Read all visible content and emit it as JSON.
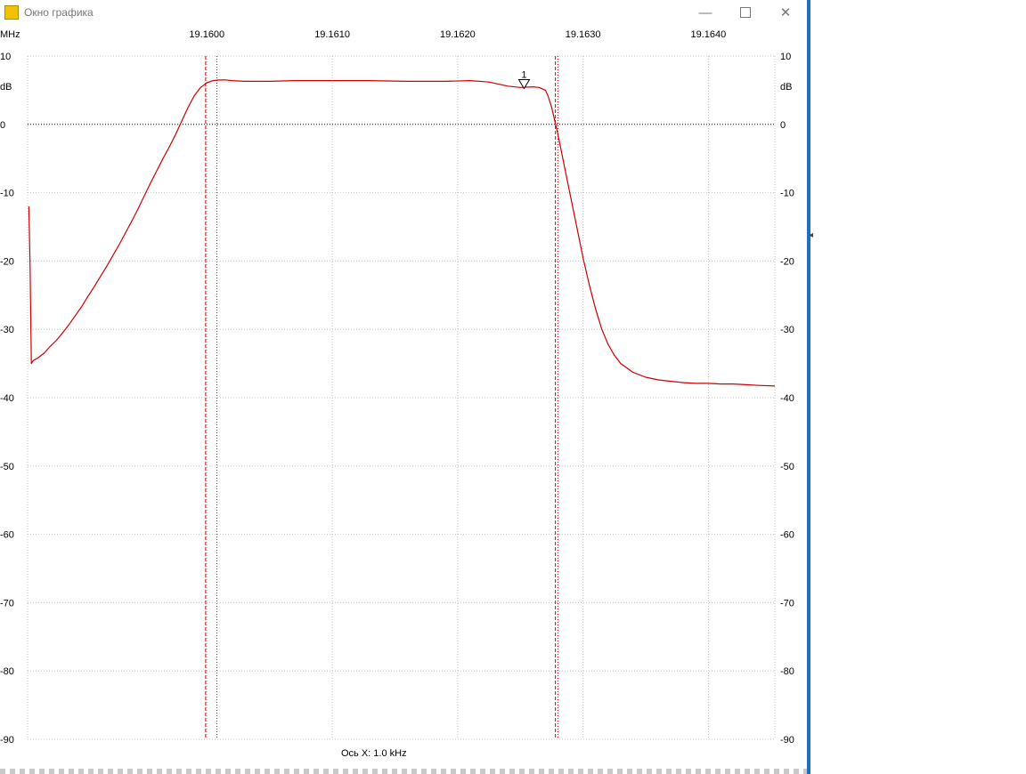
{
  "window": {
    "title": "Окно графика",
    "icon": "waveform-icon",
    "controls": {
      "minimize": "—",
      "maximize": "maximize-icon",
      "close": "✕"
    }
  },
  "colors": {
    "trace": "#cc0000",
    "cursor": "#cc0000",
    "grid": "#c0c0c0",
    "reference": "#000000",
    "frame_accent": "#1d6fc4"
  },
  "chart_data": {
    "type": "line",
    "x_unit_label": "MHz",
    "y_unit_label": "dB",
    "xlabel": "Ось X: 1.0 kHz",
    "x_tick_labels": [
      "19.1600",
      "19.1610",
      "19.1620",
      "19.1630",
      "19.1640"
    ],
    "x_ticks": [
      19.16,
      19.161,
      19.162,
      19.163,
      19.164
    ],
    "xlim": [
      19.15857,
      19.16453
    ],
    "ylim": [
      -90,
      10
    ],
    "y_ticks": [
      10,
      0,
      -10,
      -20,
      -30,
      -40,
      -50,
      -60,
      -70,
      -80,
      -90
    ],
    "grid": true,
    "reference_line_y": 0,
    "cursor_lines_x": [
      19.15999,
      19.16008,
      19.16278,
      19.1628
    ],
    "marker": {
      "label": "1",
      "x": 19.16253,
      "y": 5.5
    },
    "series": [
      {
        "x": [
          19.15858,
          19.15859,
          19.1586,
          19.15861,
          19.15862,
          19.15865,
          19.1587,
          19.15875,
          19.1588,
          19.15885,
          19.1589,
          19.15895,
          19.159,
          19.15905,
          19.1591,
          19.15915,
          19.1592,
          19.15925,
          19.1593,
          19.15935,
          19.1594,
          19.15945,
          19.1595,
          19.15955,
          19.1596,
          19.15965,
          19.1597,
          19.15975,
          19.1598,
          19.15985,
          19.1599,
          19.15995,
          19.16,
          19.16005,
          19.1601,
          19.16015,
          19.1602,
          19.1603,
          19.1605,
          19.1607,
          19.161,
          19.1613,
          19.1616,
          19.1619,
          19.1621,
          19.16225,
          19.1624,
          19.1625,
          19.1626,
          19.16265,
          19.1627,
          19.16272,
          19.16275,
          19.1628,
          19.16285,
          19.1629,
          19.16295,
          19.163,
          19.16305,
          19.1631,
          19.16315,
          19.1632,
          19.16325,
          19.1633,
          19.1634,
          19.1635,
          19.1636,
          19.1637,
          19.1638,
          19.1639,
          19.164,
          19.1641,
          19.1642,
          19.1643,
          19.1644,
          19.16453
        ],
        "y": [
          -12,
          -21,
          -35,
          -34.7,
          -34.5,
          -34.2,
          -33.5,
          -32.5,
          -31.6,
          -30.5,
          -29.3,
          -28,
          -26.7,
          -25.2,
          -23.8,
          -22.3,
          -20.8,
          -19.2,
          -17.6,
          -15.9,
          -14.2,
          -12.4,
          -10.5,
          -8.6,
          -6.8,
          -5,
          -3.3,
          -1.5,
          0.5,
          2.5,
          4.2,
          5.4,
          6.1,
          6.4,
          6.5,
          6.5,
          6.4,
          6.3,
          6.3,
          6.4,
          6.4,
          6.4,
          6.3,
          6.3,
          6.4,
          6.2,
          5.6,
          5.4,
          5.5,
          5.4,
          5,
          4.2,
          2.5,
          -1.5,
          -6,
          -10.5,
          -15,
          -19.5,
          -23.5,
          -27,
          -30,
          -32.2,
          -33.8,
          -35,
          -36.3,
          -37,
          -37.4,
          -37.6,
          -37.8,
          -37.9,
          -37.9,
          -38,
          -38,
          -38.1,
          -38.2,
          -38.3
        ]
      }
    ]
  }
}
